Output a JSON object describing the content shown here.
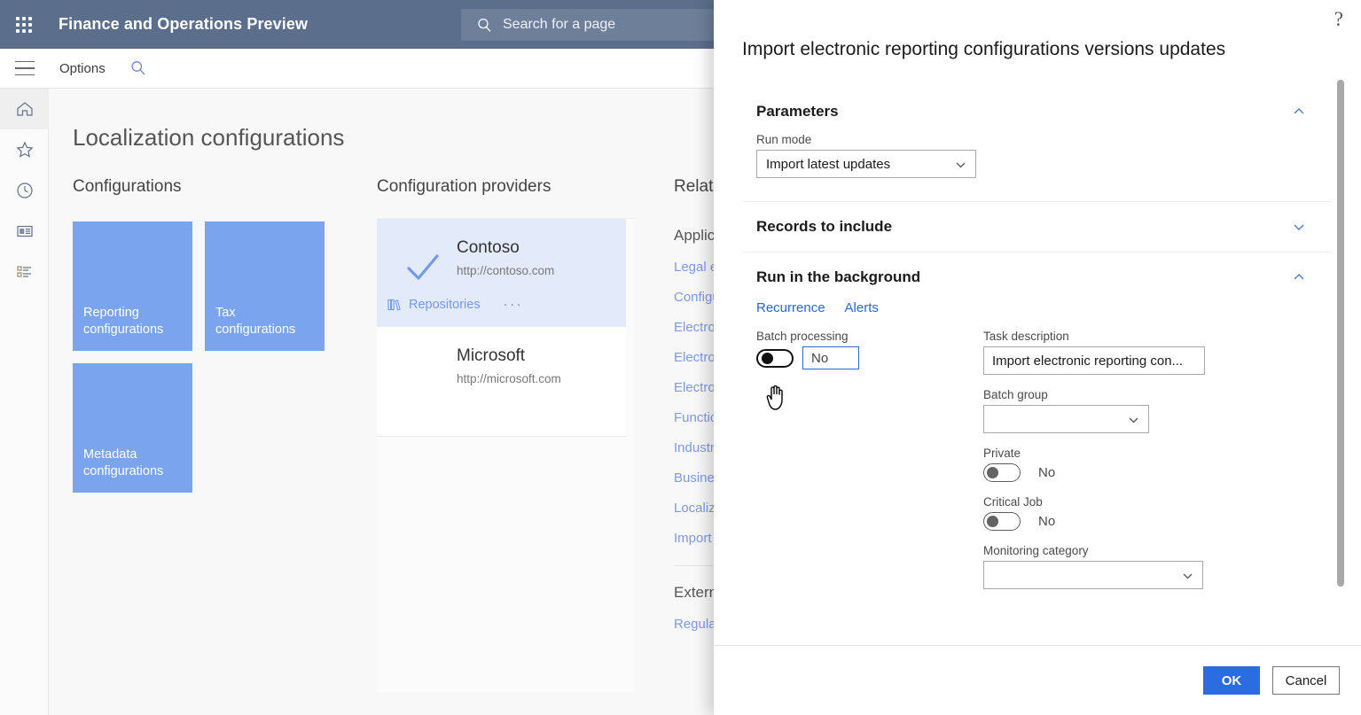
{
  "topbar": {
    "waffle_icon": "app-launcher-icon",
    "app_title": "Finance and Operations Preview",
    "search_icon": "search-icon",
    "search_placeholder": "Search for a page"
  },
  "toolbar": {
    "menu_icon": "hamburger-icon",
    "options_label": "Options",
    "search_icon": "search-icon"
  },
  "rail": {
    "items": [
      {
        "icon": "home-icon",
        "name": "home"
      },
      {
        "icon": "star-icon",
        "name": "favorites"
      },
      {
        "icon": "clock-icon",
        "name": "recent"
      },
      {
        "icon": "workspace-icon",
        "name": "workspaces"
      },
      {
        "icon": "list-icon",
        "name": "modules"
      }
    ]
  },
  "page": {
    "title": "Localization configurations",
    "configurations": {
      "heading": "Configurations",
      "tiles": [
        {
          "label": "Reporting configurations"
        },
        {
          "label": "Tax configurations"
        },
        {
          "label": "Metadata configurations"
        }
      ]
    },
    "providers": {
      "heading": "Configuration providers",
      "items": [
        {
          "name": "Contoso",
          "url": "http://contoso.com",
          "selected": true,
          "check_icon": "checkmark-icon",
          "repositories_label": "Repositories",
          "repositories_icon": "books-icon",
          "more_label": "···"
        },
        {
          "name": "Microsoft",
          "url": "http://microsoft.com",
          "selected": false
        }
      ]
    },
    "related": {
      "heading": "Related links",
      "subheading": "Application specific",
      "links": [
        "Legal entities",
        "Configurations",
        "Electronic reporting",
        "Electronic reporting destinations",
        "Electronic reporting parameters",
        "Function type parameters",
        "Industry parameters",
        "Business document management",
        "Localization configurations",
        "Import configurations"
      ],
      "subheading2": "External links",
      "links2": [
        "Regulatory configuration service"
      ]
    }
  },
  "dialog": {
    "help_icon": "help-icon",
    "help_glyph": "?",
    "title": "Import electronic reporting configurations versions updates",
    "sections": {
      "parameters": {
        "title": "Parameters",
        "chevron": "chevron-up-icon",
        "expanded": true,
        "run_mode": {
          "label": "Run mode",
          "value": "Import latest updates",
          "dropdown_icon": "chevron-down-icon"
        }
      },
      "records_to_include": {
        "title": "Records to include",
        "chevron": "chevron-down-icon",
        "expanded": false
      },
      "run_in_background": {
        "title": "Run in the background",
        "chevron": "chevron-up-icon",
        "expanded": true,
        "tabs": [
          {
            "label": "Recurrence"
          },
          {
            "label": "Alerts"
          }
        ],
        "batch_processing": {
          "label": "Batch processing",
          "value": "No",
          "toggle_state": "off",
          "focused": true
        },
        "task_description": {
          "label": "Task description",
          "value": "Import electronic reporting con..."
        },
        "batch_group": {
          "label": "Batch group",
          "value": "",
          "dropdown_icon": "chevron-down-icon"
        },
        "private": {
          "label": "Private",
          "value": "No",
          "toggle_state": "off"
        },
        "critical_job": {
          "label": "Critical Job",
          "value": "No",
          "toggle_state": "off"
        },
        "monitoring_category": {
          "label": "Monitoring category",
          "value": "",
          "dropdown_icon": "chevron-down-icon"
        }
      }
    },
    "footer": {
      "ok_label": "OK",
      "cancel_label": "Cancel"
    },
    "scrollbar": "vertical-scrollbar"
  },
  "cursor": {
    "icon": "hand-pointer-cursor"
  },
  "colors": {
    "header_bg": "#5b6e8c",
    "tile_blue": "#7ba4ee",
    "accent_blue": "#2b6ce0",
    "link_blue": "#8098e8",
    "selected_card": "#e3ebfb",
    "content_bg": "#f8f8f8"
  }
}
